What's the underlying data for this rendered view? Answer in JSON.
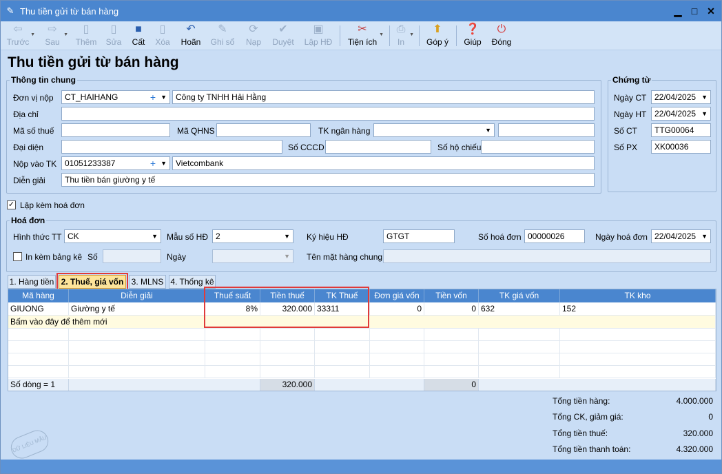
{
  "window": {
    "title": "Thu tiền gửi từ bán hàng"
  },
  "toolbar": {
    "items": [
      {
        "id": "prev",
        "label": "Trước",
        "icon": "arrow-left-icon",
        "disabled": true
      },
      {
        "id": "next",
        "label": "Sau",
        "icon": "arrow-right-icon",
        "disabled": true
      },
      {
        "id": "add",
        "label": "Thêm",
        "icon": "new-doc-icon",
        "disabled": true
      },
      {
        "id": "edit",
        "label": "Sửa",
        "icon": "edit-doc-icon",
        "disabled": true
      },
      {
        "id": "save",
        "label": "Cất",
        "icon": "save-icon",
        "disabled": false
      },
      {
        "id": "delete",
        "label": "Xóa",
        "icon": "delete-doc-icon",
        "disabled": true
      },
      {
        "id": "undo",
        "label": "Hoãn",
        "icon": "undo-icon",
        "disabled": false
      },
      {
        "id": "post",
        "label": "Ghi sổ",
        "icon": "pencil-icon",
        "disabled": true
      },
      {
        "id": "load",
        "label": "Nạp",
        "icon": "refresh-icon",
        "disabled": true
      },
      {
        "id": "approve",
        "label": "Duyệt",
        "icon": "check-icon",
        "disabled": true
      },
      {
        "id": "invoice",
        "label": "Lập HĐ",
        "icon": "invoice-icon",
        "disabled": true
      },
      {
        "id": "utilities",
        "label": "Tiện ích",
        "icon": "tools-icon",
        "disabled": false
      },
      {
        "id": "print",
        "label": "In",
        "icon": "printer-icon",
        "disabled": true
      },
      {
        "id": "feedback",
        "label": "Góp ý",
        "icon": "feedback-icon",
        "disabled": false
      },
      {
        "id": "help",
        "label": "Giúp",
        "icon": "help-icon",
        "disabled": false
      },
      {
        "id": "close",
        "label": "Đóng",
        "icon": "power-icon",
        "disabled": false
      }
    ]
  },
  "page_title": "Thu tiền gửi từ bán hàng",
  "general": {
    "legend": "Thông tin chung",
    "payer_label": "Đơn vị nộp",
    "payer_code": "CT_HAIHANG",
    "payer_name": "Công ty TNHH Hải Hằng",
    "address_label": "Địa chỉ",
    "address": "",
    "tax_code_label": "Mã số thuế",
    "tax_code": "",
    "qhns_label": "Mã QHNS",
    "qhns": "",
    "bank_account_label": "TK ngân hàng",
    "bank_account": "",
    "bank_account_extra": "",
    "representative_label": "Đại diện",
    "representative": "",
    "cccd_label": "Số CCCD",
    "cccd": "",
    "passport_label": "Số hộ chiếu",
    "passport": "",
    "deposit_account_label": "Nộp vào TK",
    "deposit_account": "01051233387",
    "deposit_bank": "Vietcombank",
    "description_label": "Diễn giải",
    "description": "Thu tiền bán giường y tế"
  },
  "voucher": {
    "legend": "Chứng từ",
    "date_ct_label": "Ngày CT",
    "date_ct": "22/04/2025",
    "date_ht_label": "Ngày HT",
    "date_ht": "22/04/2025",
    "no_ct_label": "Số CT",
    "no_ct": "TTG00064",
    "no_px_label": "Số PX",
    "no_px": "XK00036"
  },
  "with_invoice": {
    "label": "Lập kèm hoá đơn",
    "checked": true
  },
  "invoice": {
    "legend": "Hoá đơn",
    "payment_method_label": "Hình thức TT",
    "payment_method": "CK",
    "template_label": "Mẫu số HĐ",
    "template": "2",
    "symbol_label": "Ký hiệu HĐ",
    "symbol": "GTGT",
    "number_label": "Số hoá đơn",
    "number": "00000026",
    "date_label": "Ngày hoá đơn",
    "date": "22/04/2025",
    "print_list_label": "In kèm bảng kê",
    "print_list_checked": false,
    "list_no_label": "Số",
    "list_no": "",
    "list_date_label": "Ngày",
    "list_date": "",
    "common_item_label": "Tên mặt hàng chung",
    "common_item": ""
  },
  "tabs": [
    {
      "label": "1. Hàng tiền",
      "active": false
    },
    {
      "label": "2. Thuế, giá vốn",
      "active": true
    },
    {
      "label": "3. MLNS",
      "active": false
    },
    {
      "label": "4. Thống kê",
      "active": false
    }
  ],
  "grid": {
    "columns": [
      "Mã hàng",
      "Diễn giải",
      "Thuế suất",
      "Tiền thuế",
      "TK Thuế",
      "Đơn giá vốn",
      "Tiền vốn",
      "TK giá vốn",
      "TK kho"
    ],
    "rows": [
      [
        "GIUONG",
        "Giường y tế",
        "8%",
        "320.000",
        "33311",
        "0",
        "0",
        "632",
        "152"
      ]
    ],
    "add_row_text": "Bấm vào đây để thêm mới",
    "footer": {
      "row_count": "Số dòng = 1",
      "tax_total": "320.000",
      "cost_total": "0"
    }
  },
  "summary": [
    {
      "label": "Tổng tiền hàng:",
      "value": "4.000.000"
    },
    {
      "label": "Tổng CK, giảm giá:",
      "value": "0"
    },
    {
      "label": "Tổng tiền thuế:",
      "value": "320.000"
    },
    {
      "label": "Tổng tiền thanh toán:",
      "value": "4.320.000"
    }
  ],
  "watermark": "DỮ LIỆU MẪU",
  "colors": {
    "title_bar": "#4a86cf",
    "grid_header": "#4a86cf",
    "active_tab": "#fde49a",
    "highlight": "#e03a3a",
    "new_row": "#fffbe0"
  }
}
